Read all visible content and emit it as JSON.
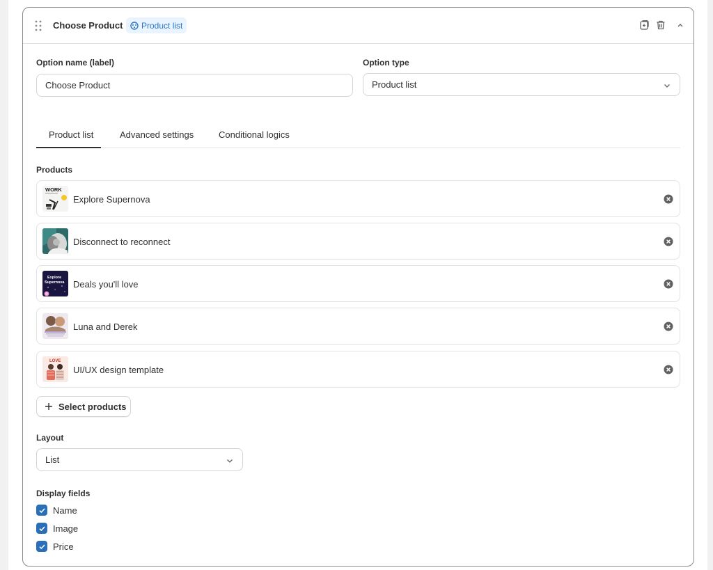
{
  "header": {
    "title": "Choose Product",
    "badge_label": "Product list",
    "badge_icon": "product-list-icon"
  },
  "option_name": {
    "label": "Option name (label)",
    "value": "Choose Product"
  },
  "option_type": {
    "label": "Option type",
    "value": "Product list"
  },
  "tabs": [
    {
      "label": "Product list",
      "active": true
    },
    {
      "label": "Advanced settings",
      "active": false
    },
    {
      "label": "Conditional logics",
      "active": false
    }
  ],
  "products": {
    "label": "Products",
    "items": [
      {
        "name": "Explore Supernova"
      },
      {
        "name": "Disconnect to reconnect"
      },
      {
        "name": "Deals you'll love"
      },
      {
        "name": "Luna and Derek"
      },
      {
        "name": "UI/UX design template"
      }
    ],
    "select_button": "Select products"
  },
  "layout": {
    "label": "Layout",
    "value": "List"
  },
  "display_fields": {
    "label": "Display fields",
    "items": [
      {
        "label": "Name",
        "checked": true
      },
      {
        "label": "Image",
        "checked": true
      },
      {
        "label": "Price",
        "checked": true
      }
    ]
  },
  "thumb_text": {
    "work": "WORK",
    "explore": "Explore",
    "supernova": "Supernova",
    "love": "LOVE"
  },
  "colors": {
    "accent": "#2a6fb8",
    "badge_bg": "#eaf4ff",
    "badge_text": "#2a77c9",
    "border": "#e3e3e3"
  }
}
